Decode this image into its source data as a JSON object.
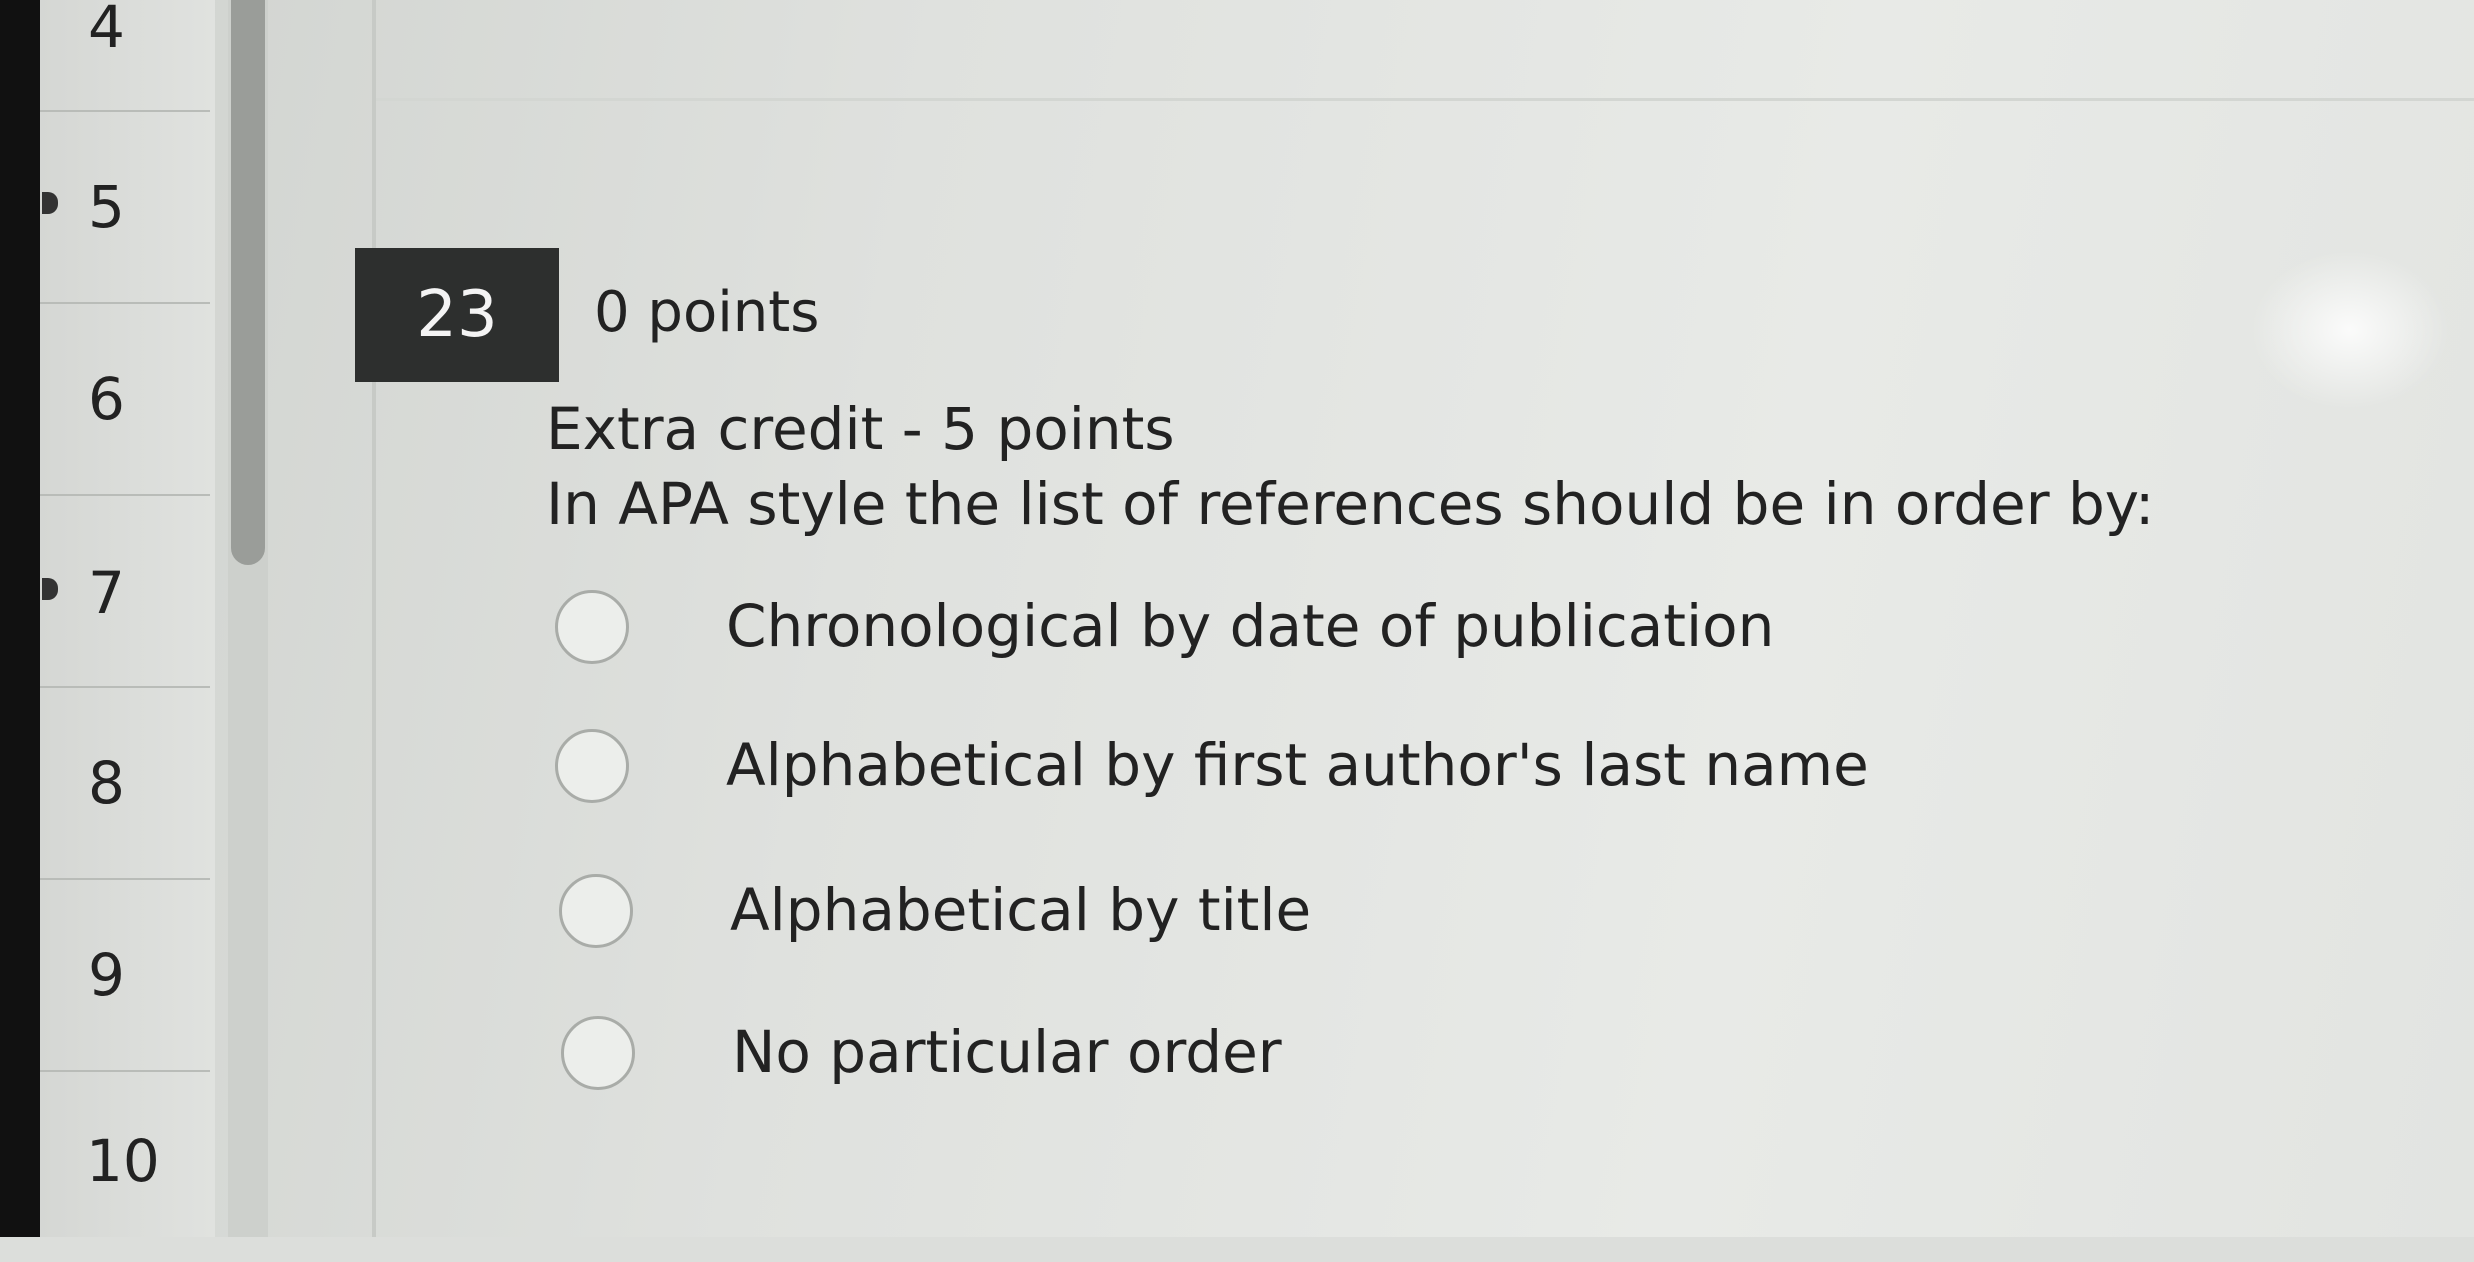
{
  "question_nav": {
    "items": [
      {
        "number": "4",
        "answered": false
      },
      {
        "number": "5",
        "answered": true
      },
      {
        "number": "6",
        "answered": false
      },
      {
        "number": "7",
        "answered": true
      },
      {
        "number": "8",
        "answered": false
      },
      {
        "number": "9",
        "answered": false
      },
      {
        "number": "10",
        "answered": false
      }
    ]
  },
  "question": {
    "number": "23",
    "points": "0 points",
    "line1": "Extra credit - 5 points",
    "line2": "In APA style the list of references should be in order by:",
    "options": [
      {
        "label": "Chronological by date of publication",
        "selected": false
      },
      {
        "label": "Alphabetical by first author's last name",
        "selected": false
      },
      {
        "label": "Alphabetical by title",
        "selected": false
      },
      {
        "label": "No particular order",
        "selected": false
      }
    ]
  },
  "colors": {
    "number_box_bg": "#2d2f2e",
    "number_box_text": "#f4f4f4",
    "text": "#222222",
    "radio_border": "#a9aca8"
  }
}
